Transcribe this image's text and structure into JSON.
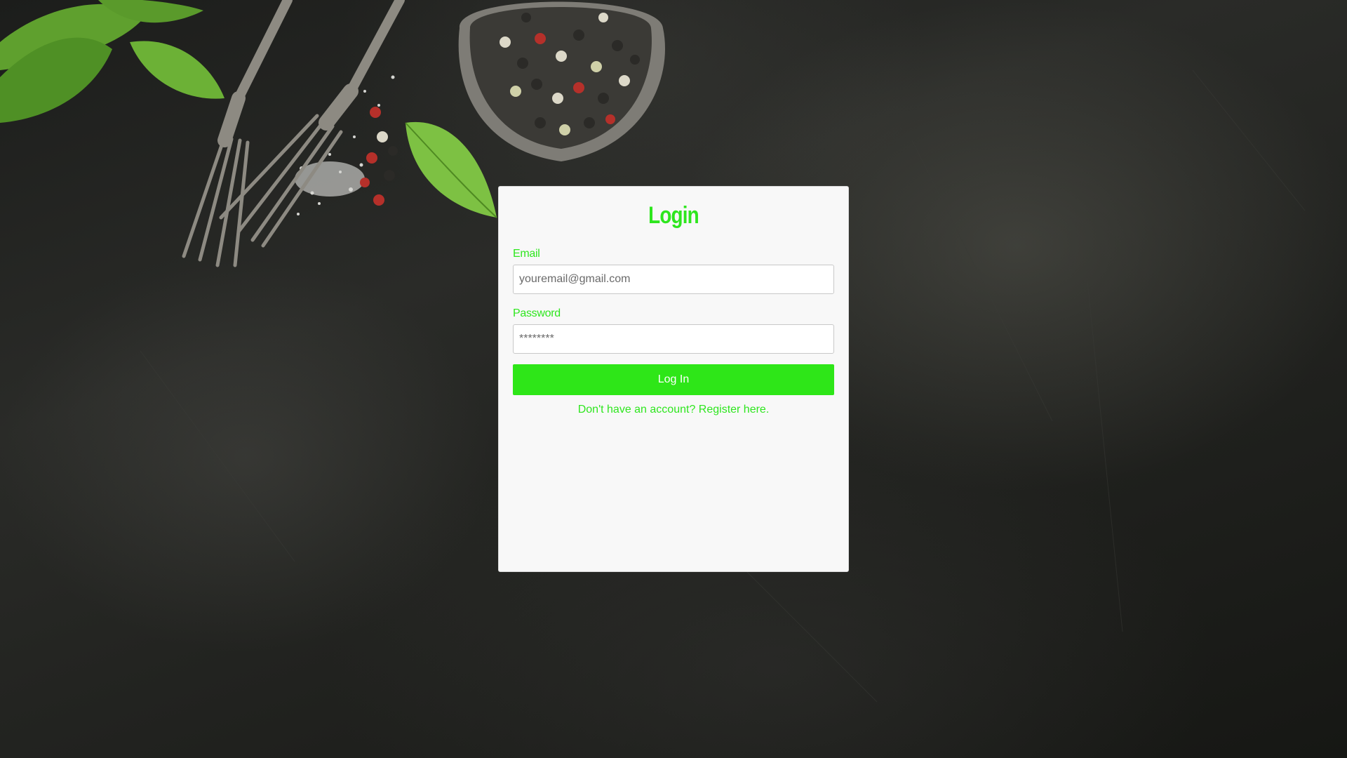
{
  "login": {
    "title": "Login",
    "email_label": "Email",
    "email_placeholder": "youremail@gmail.com",
    "password_label": "Password",
    "password_placeholder": "********",
    "submit_label": "Log In",
    "register_text": "Don't have an account? Register here."
  },
  "colors": {
    "accent": "#2ee61e",
    "card_background": "#f8f8f8",
    "page_background": "#1e1f1c"
  },
  "decor": {
    "icons": [
      "basil-leaf-icon",
      "fork-icon",
      "peppercorn-bowl-icon",
      "salt-icon"
    ]
  }
}
